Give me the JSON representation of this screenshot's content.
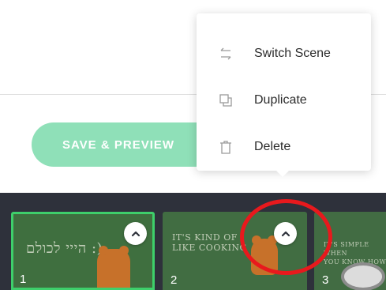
{
  "save_button": {
    "label": "SAVE & PREVIEW"
  },
  "context_menu": {
    "items": [
      {
        "label": "Switch Scene",
        "icon": "switch-arrows-icon"
      },
      {
        "label": "Duplicate",
        "icon": "duplicate-icon"
      },
      {
        "label": "Delete",
        "icon": "trash-icon"
      }
    ]
  },
  "timeline": {
    "scenes": [
      {
        "number": "1",
        "caption": "הייי לכולם :)",
        "selected": true
      },
      {
        "number": "2",
        "caption": "IT'S KIND OF\nLIKE COOKING",
        "selected": false
      },
      {
        "number": "3",
        "caption": "IT'S SIMPLE WHEN\nYOU KNOW HOW",
        "selected": false
      }
    ]
  },
  "colors": {
    "accent_green": "#3ecf6b",
    "button_green": "#8fe0b8",
    "timeline_bg": "#2e313b",
    "annotation_red": "#e8191d"
  }
}
